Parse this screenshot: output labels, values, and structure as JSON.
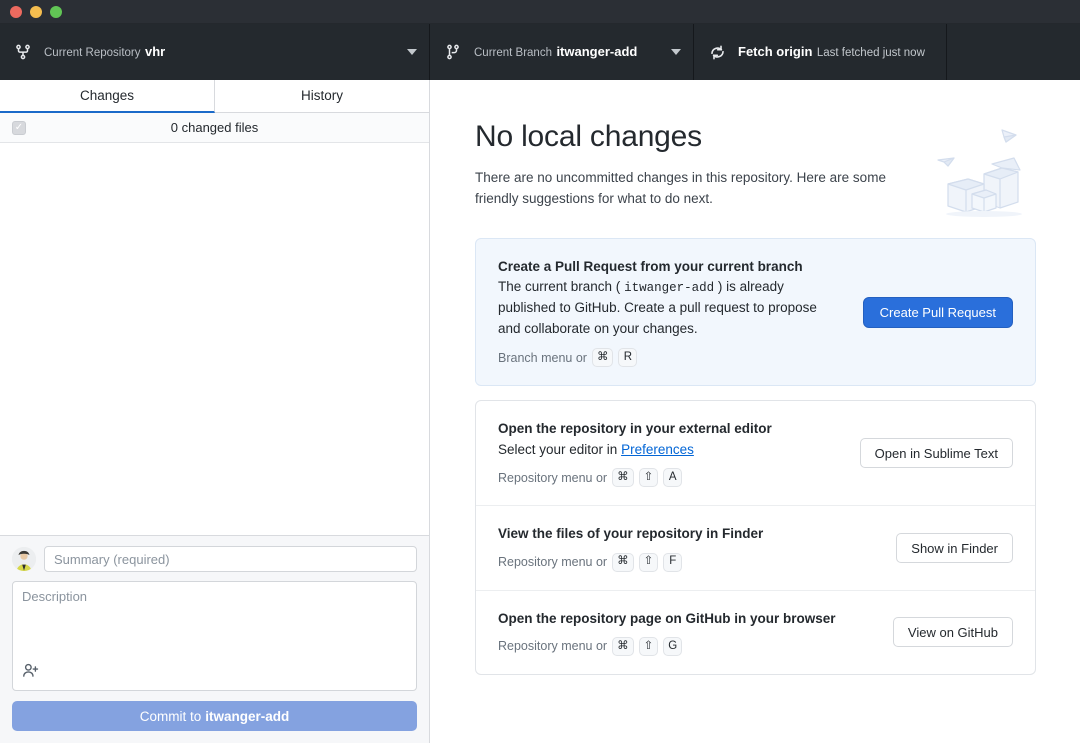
{
  "window": {
    "traffic_lights": [
      "close",
      "minimize",
      "zoom"
    ],
    "colors": {
      "titlebar": "#2b2f35",
      "toolbar": "#24292e",
      "accent": "#2a6fdb",
      "tab_underline": "#1b6ac9",
      "commit_button": "#84a2e0",
      "link": "#0366d6"
    }
  },
  "toolbar": {
    "repository": {
      "label": "Current Repository",
      "value": "vhr",
      "icon": "repo-icon"
    },
    "branch": {
      "label": "Current Branch",
      "value": "itwanger-add",
      "icon": "branch-icon"
    },
    "fetch": {
      "label": "Fetch origin",
      "sublabel": "Last fetched just now",
      "icon": "sync-icon"
    }
  },
  "sidebar": {
    "tabs": [
      {
        "label": "Changes",
        "active": true
      },
      {
        "label": "History",
        "active": false
      }
    ],
    "changed_files_text": "0 changed files",
    "commit_form": {
      "summary_placeholder": "Summary (required)",
      "summary_value": "",
      "description_placeholder": "Description",
      "description_value": "",
      "coauthor_icon": "person-add-icon",
      "commit_button_prefix": "Commit to ",
      "commit_button_branch": "itwanger-add"
    }
  },
  "main": {
    "title": "No local changes",
    "subtitle": "There are no uncommitted changes in this repository. Here are some friendly suggestions for what to do next.",
    "illustration": "boxes-and-paper-planes-illustration",
    "suggestions": [
      {
        "id": "pull-request",
        "primary": true,
        "title": "Create a Pull Request from your current branch",
        "desc_before": "The current branch ( ",
        "desc_mono": "itwanger-add",
        "desc_after": " ) is already published to GitHub. Create a pull request to propose and collaborate on your changes.",
        "menu_text": "Branch menu or",
        "keys": [
          "⌘",
          "R"
        ],
        "button": "Create Pull Request"
      },
      {
        "id": "external-editor",
        "primary": false,
        "title": "Open the repository in your external editor",
        "desc_before": "Select your editor in ",
        "link": "Preferences",
        "desc_after": "",
        "menu_text": "Repository menu or",
        "keys": [
          "⌘",
          "⇧",
          "A"
        ],
        "button": "Open in Sublime Text"
      },
      {
        "id": "show-in-finder",
        "primary": false,
        "title": "View the files of your repository in Finder",
        "menu_text": "Repository menu or",
        "keys": [
          "⌘",
          "⇧",
          "F"
        ],
        "button": "Show in Finder"
      },
      {
        "id": "view-on-github",
        "primary": false,
        "title": "Open the repository page on GitHub in your browser",
        "menu_text": "Repository menu or",
        "keys": [
          "⌘",
          "⇧",
          "G"
        ],
        "button": "View on GitHub"
      }
    ]
  }
}
